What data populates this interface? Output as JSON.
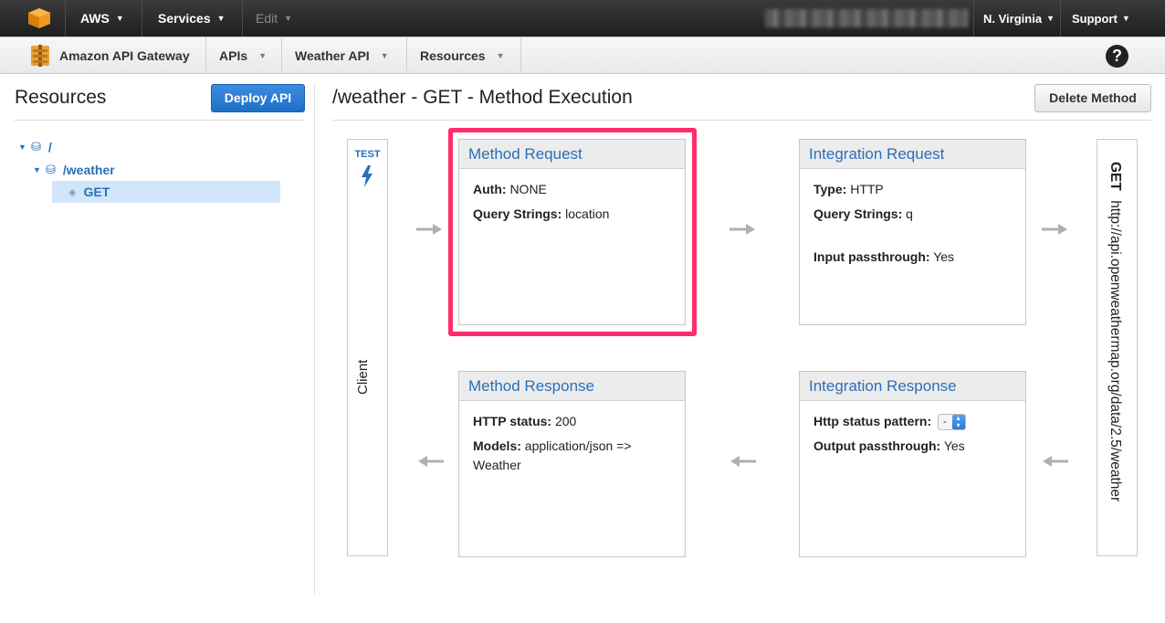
{
  "topbar": {
    "aws_label": "AWS",
    "services_label": "Services",
    "edit_label": "Edit",
    "region_label": "N. Virginia",
    "support_label": "Support"
  },
  "navbar": {
    "service_label": "Amazon API Gateway",
    "apis_label": "APIs",
    "api_name": "Weather API",
    "resources_label": "Resources",
    "help_glyph": "?"
  },
  "sidebar": {
    "title": "Resources",
    "deploy_label": "Deploy API",
    "tree": [
      {
        "label": "/"
      },
      {
        "label": "/weather"
      },
      {
        "label": "GET"
      }
    ]
  },
  "main": {
    "title": "/weather - GET - Method Execution",
    "delete_label": "Delete Method",
    "client": {
      "test_label": "TEST",
      "label": "Client"
    },
    "endpoint": {
      "method": "GET",
      "url": "http://api.openweathermap.org/data/2.5/weather"
    },
    "method_request": {
      "title": "Method Request",
      "auth_key": "Auth:",
      "auth_val": "NONE",
      "qs_key": "Query Strings:",
      "qs_val": "location"
    },
    "integration_request": {
      "title": "Integration Request",
      "type_key": "Type:",
      "type_val": "HTTP",
      "qs_key": "Query Strings:",
      "qs_val": "q",
      "passthrough_key": "Input passthrough:",
      "passthrough_val": "Yes"
    },
    "method_response": {
      "title": "Method Response",
      "status_key": "HTTP status:",
      "status_val": "200",
      "models_key": "Models:",
      "models_val": "application/json => Weather"
    },
    "integration_response": {
      "title": "Integration Response",
      "pattern_key": "Http status pattern:",
      "pattern_val": "-",
      "passthrough_key": "Output passthrough:",
      "passthrough_val": "Yes"
    }
  },
  "colors": {
    "accent": "#2a6fb7",
    "highlight": "#ff2d6b",
    "deploy_button": "#1f6fc7"
  }
}
